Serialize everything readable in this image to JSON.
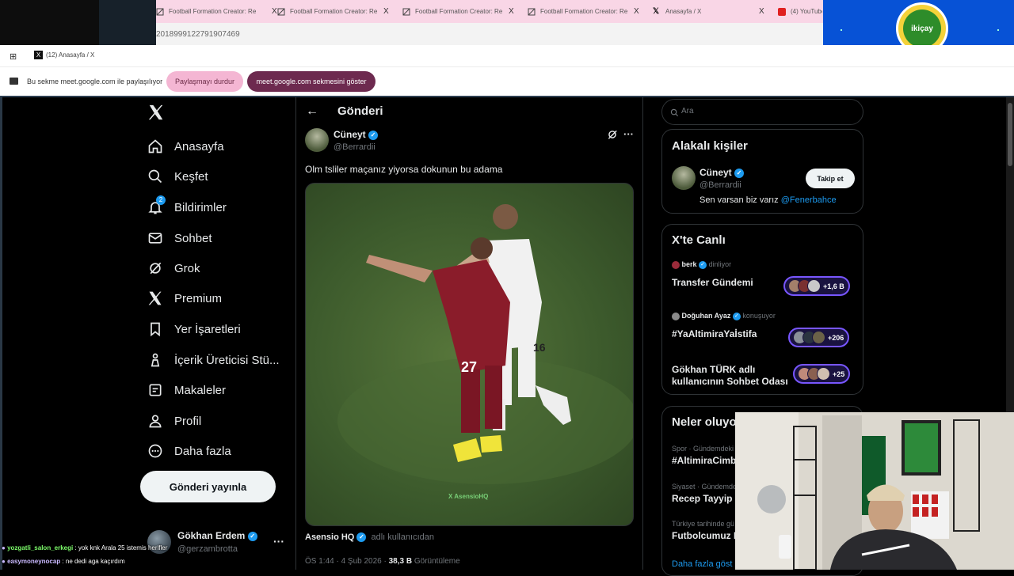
{
  "browser": {
    "tabs": [
      {
        "title": "Football Formation Creator: Re",
        "icon": "document-icon"
      },
      {
        "title": "Football Formation Creator: Re",
        "icon": "document-icon"
      },
      {
        "title": "Football Formation Creator: Re",
        "icon": "document-icon"
      },
      {
        "title": "Football Formation Creator: Re",
        "icon": "document-icon"
      },
      {
        "title": "Anasayfa / X",
        "icon": "x-logo-icon"
      },
      {
        "title": "(4) YouTube",
        "icon": "youtube-icon"
      }
    ],
    "close_glyph": "X",
    "url_fragment": "2018999122791907469",
    "tab2_title": "(12) Anasayfa / X",
    "brand_logo_text": "ikiçay",
    "accent_pink": "#f9d6e6",
    "accent_logo_blue": "#0752d6"
  },
  "share_bar": {
    "message": "Bu sekme meet.google.com ile paylaşılıyor",
    "stop_label": "Paylaşmayı durdur",
    "show_label": "meet.google.com sekmesini göster"
  },
  "nav": {
    "items": [
      {
        "label": "Anasayfa",
        "icon": "home-icon"
      },
      {
        "label": "Keşfet",
        "icon": "search-icon"
      },
      {
        "label": "Bildirimler",
        "icon": "bell-icon",
        "badge": "2"
      },
      {
        "label": "Sohbet",
        "icon": "mail-icon"
      },
      {
        "label": "Grok",
        "icon": "grok-icon"
      },
      {
        "label": "Premium",
        "icon": "x-logo-icon"
      },
      {
        "label": "Yer İşaretleri",
        "icon": "bookmark-icon"
      },
      {
        "label": "İçerik Üreticisi Stü...",
        "icon": "creator-studio-icon"
      },
      {
        "label": "Makaleler",
        "icon": "article-icon"
      },
      {
        "label": "Profil",
        "icon": "person-icon"
      },
      {
        "label": "Daha fazla",
        "icon": "more-circle-icon"
      }
    ],
    "post_button": "Gönderi yayınla",
    "account": {
      "name": "Gökhan Erdem",
      "handle": "@gerzambrotta"
    }
  },
  "post": {
    "header_title": "Gönderi",
    "author_name": "Cüneyt",
    "author_handle": "@Berrardii",
    "text": "Olm tsliler maçanız yiyorsa dokunun bu adama",
    "video_watermark": "X AsensioHQ",
    "player_number_a": "27",
    "player_number_b": "16",
    "source_name": "Asensio HQ",
    "source_suffix": "adlı kullanıcıdan",
    "meta_time": "ÖS 1:44 · 4 Şub 2026 ·",
    "views_count": "38,3 B",
    "views_label": "Görüntüleme"
  },
  "sidebar": {
    "search_placeholder": "Ara",
    "related": {
      "title": "Alakalı kişiler",
      "name": "Cüneyt",
      "handle": "@Berrardii",
      "follow_label": "Takip et",
      "bio_text": "Sen varsan biz varız",
      "bio_mention": "@Fenerbahce"
    },
    "live": {
      "title": "X'te Canlı",
      "items": [
        {
          "host": "berk",
          "status": "dinliyor",
          "title": "Transfer Gündemi",
          "count": "+1,6 B"
        },
        {
          "host": "Doğuhan Ayaz",
          "status": "konuşuyor",
          "title": "#YaAltimiraYaİstifa",
          "count": "+206"
        },
        {
          "host": "",
          "status": "",
          "title": "Gökhan TÜRK adlı kullanıcının Sohbet Odası",
          "count": "+25"
        }
      ]
    },
    "trends": {
      "title": "Neler oluyor",
      "items": [
        {
          "category": "Spor · Gündemdeki",
          "name": "#AltimiraCimbom"
        },
        {
          "category": "Siyaset · Gündemde",
          "name": "Recep Tayyip E"
        },
        {
          "category": "Türkiye tarihinde gü",
          "name": "Futbolcumuz N"
        }
      ],
      "show_more": "Daha fazla göst"
    }
  },
  "chat": [
    {
      "user": "yozgatli_salon_erkegi",
      "message": ": yok knk Arala 25 istemis herifler"
    },
    {
      "user": "easymoneynocap",
      "message": ": ne dedi aga kaçırdım"
    }
  ]
}
